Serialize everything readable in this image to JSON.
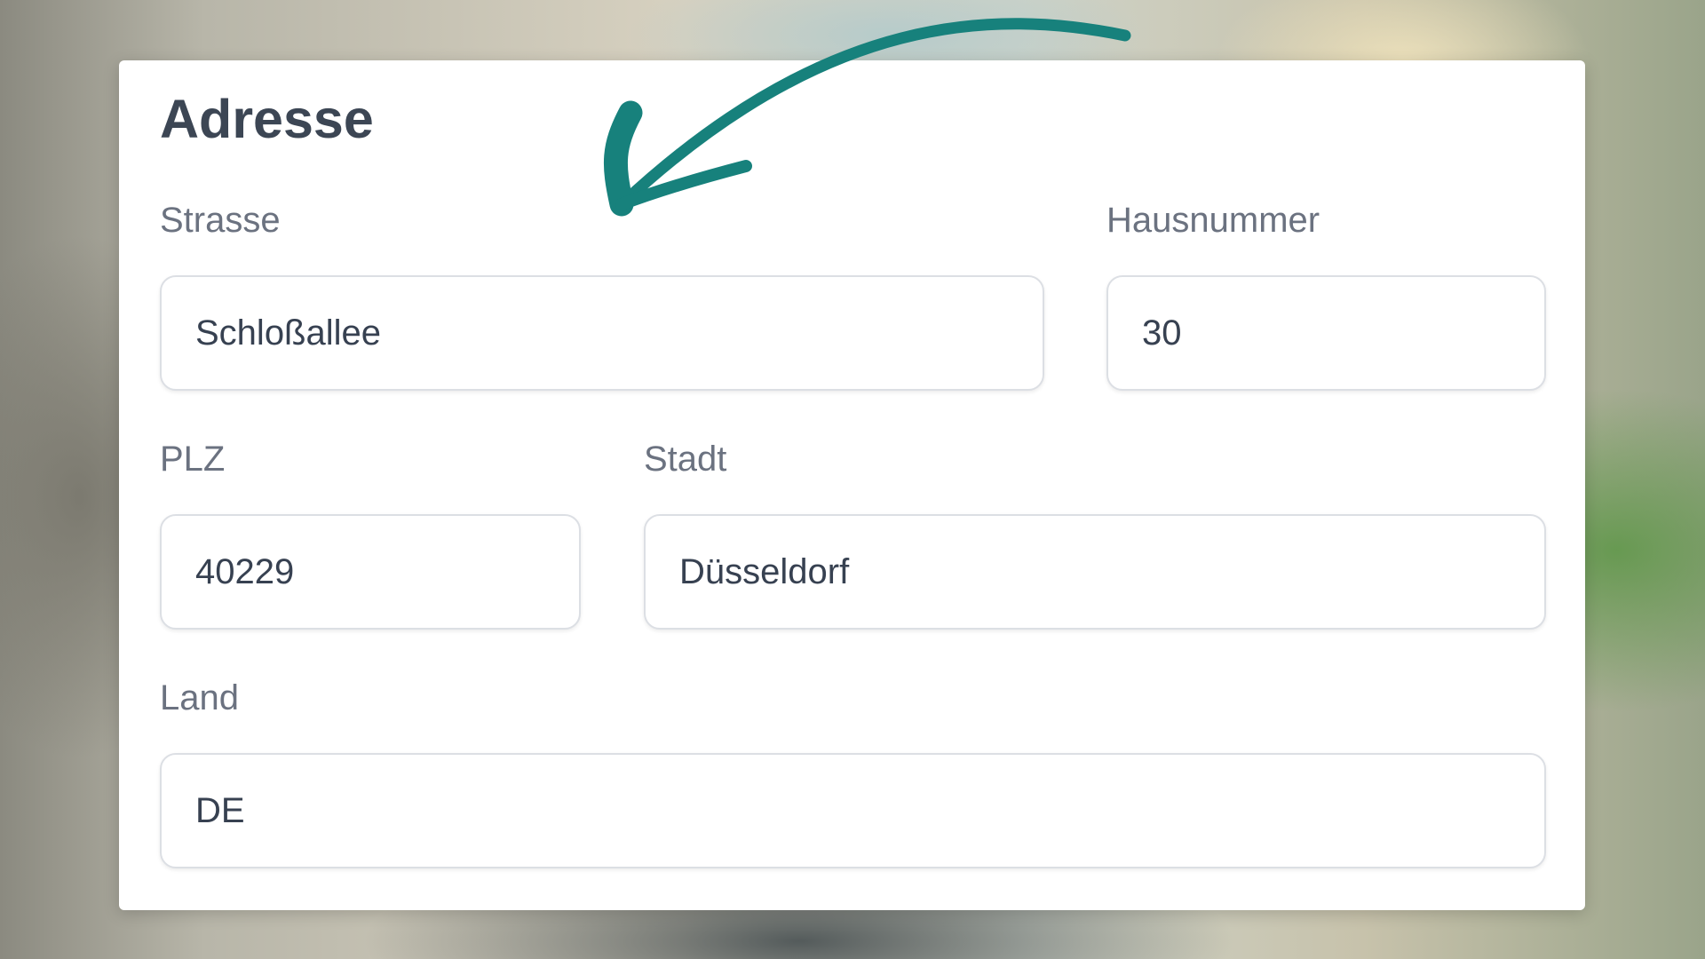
{
  "form": {
    "title": "Adresse",
    "fields": {
      "street": {
        "label": "Strasse",
        "value": "Schloßallee"
      },
      "house_number": {
        "label": "Hausnummer",
        "value": "30"
      },
      "zip": {
        "label": "PLZ",
        "value": "40229"
      },
      "city": {
        "label": "Stadt",
        "value": "Düsseldorf"
      },
      "country": {
        "label": "Land",
        "value": "DE"
      }
    }
  },
  "annotation": {
    "arrow_icon": "curved-arrow-icon",
    "color": "#17817c"
  }
}
